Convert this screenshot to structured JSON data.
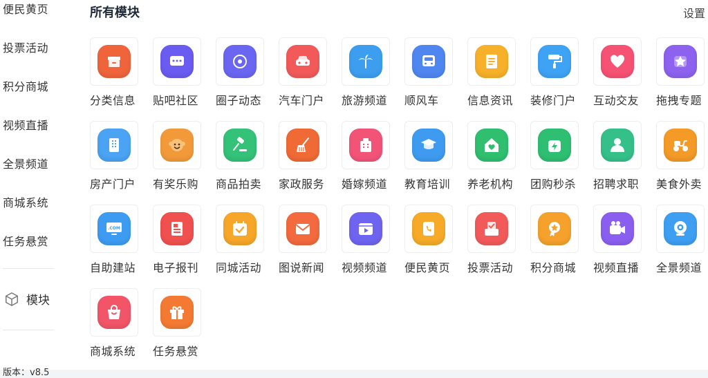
{
  "sidebar": {
    "items": [
      {
        "label": "便民黄页"
      },
      {
        "label": "投票活动"
      },
      {
        "label": "积分商城"
      },
      {
        "label": "视频直播"
      },
      {
        "label": "全景频道"
      },
      {
        "label": "商城系统"
      },
      {
        "label": "任务悬赏"
      }
    ],
    "module_label": "模块",
    "version_text": "版本：v8.5"
  },
  "header": {
    "title": "所有模块",
    "settings_label": "设置"
  },
  "modules": [
    {
      "label": "分类信息",
      "icon": "box-icon",
      "color": "#f0643c"
    },
    {
      "label": "贴吧社区",
      "icon": "chat-icon",
      "color": "#6a5cf0"
    },
    {
      "label": "圈子动态",
      "icon": "circle-icon",
      "color": "#6a66f2"
    },
    {
      "label": "汽车门户",
      "icon": "car-icon",
      "color": "#f25a5a"
    },
    {
      "label": "旅游频道",
      "icon": "palm-icon",
      "color": "#3d9ef0"
    },
    {
      "label": "顺风车",
      "icon": "bus-icon",
      "color": "#4f86f0"
    },
    {
      "label": "信息资讯",
      "icon": "document-icon",
      "color": "#f7b02a"
    },
    {
      "label": "装修门户",
      "icon": "paint-roller-icon",
      "color": "#3ea3f5"
    },
    {
      "label": "互动交友",
      "icon": "heart-icon",
      "color": "#f65273"
    },
    {
      "label": "拖拽专题",
      "icon": "star-icon",
      "color": "#8c62ee"
    },
    {
      "label": "房产门户",
      "icon": "building-icon",
      "color": "#4aa3f3"
    },
    {
      "label": "有奖乐购",
      "icon": "monkey-icon",
      "color": "#f29a3a"
    },
    {
      "label": "商品拍卖",
      "icon": "gavel-icon",
      "color": "#34c279"
    },
    {
      "label": "家政服务",
      "icon": "broom-icon",
      "color": "#f06a35"
    },
    {
      "label": "婚嫁频道",
      "icon": "hotel-icon",
      "color": "#f25478"
    },
    {
      "label": "教育培训",
      "icon": "graduation-cap-icon",
      "color": "#3f9bf0"
    },
    {
      "label": "养老机构",
      "icon": "home-heart-icon",
      "color": "#2fbf6f"
    },
    {
      "label": "团购秒杀",
      "icon": "flash-bag-icon",
      "color": "#2fbf72"
    },
    {
      "label": "招聘求职",
      "icon": "user-icon",
      "color": "#35c08a"
    },
    {
      "label": "美食外卖",
      "icon": "scooter-icon",
      "color": "#f39a27"
    },
    {
      "label": "自助建站",
      "icon": "monitor-icon",
      "color": "#3d9cf2"
    },
    {
      "label": "电子报刊",
      "icon": "newspaper-icon",
      "color": "#f0504f"
    },
    {
      "label": "同城活动",
      "icon": "calendar-icon",
      "color": "#f6a628"
    },
    {
      "label": "图说新闻",
      "icon": "mail-icon",
      "color": "#f26a3d"
    },
    {
      "label": "视频频道",
      "icon": "video-icon",
      "color": "#6f64f0"
    },
    {
      "label": "便民黄页",
      "icon": "phone-book-icon",
      "color": "#f6aa28"
    },
    {
      "label": "投票活动",
      "icon": "ballot-icon",
      "color": "#f25a5a"
    },
    {
      "label": "积分商城",
      "icon": "medal-icon",
      "color": "#f5a12c"
    },
    {
      "label": "视频直播",
      "icon": "live-camera-icon",
      "color": "#8a5ff0"
    },
    {
      "label": "全景频道",
      "icon": "panorama-camera-icon",
      "color": "#3d9ef2"
    },
    {
      "label": "商城系统",
      "icon": "shopping-bag-icon",
      "color": "#f25568"
    },
    {
      "label": "任务悬赏",
      "icon": "gift-icon",
      "color": "#f47a34"
    }
  ]
}
